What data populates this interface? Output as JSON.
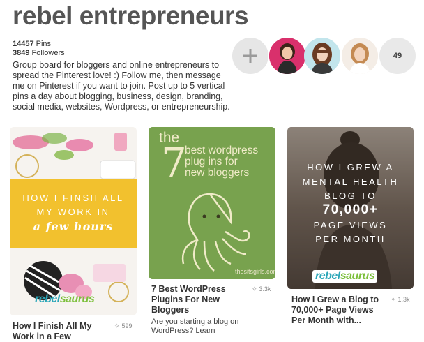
{
  "board": {
    "title": "rebel entrepreneurs",
    "pins_count": "14457",
    "pins_label": "Pins",
    "followers_count": "3849",
    "followers_label": "Followers",
    "description": "Group board for bloggers and online entrepreneurs to spread the Pinterest love! :) Follow me, then message me on Pinterest if you want to join. Post up to 5 vertical pins a day about blogging, business, design, branding, social media, websites, Wordpress, or entrepreneurship."
  },
  "collaborators": {
    "add_icon": "plus-icon",
    "more_count": "49"
  },
  "pins": [
    {
      "title": "How I Finish All My Work in a Few",
      "saves": "599",
      "image_text": [
        "HOW I FINSH ALL",
        "MY WORK IN",
        "a few hours"
      ],
      "logo": [
        "rebel",
        "saurus"
      ]
    },
    {
      "title": "7 Best WordPress Plugins For New Bloggers",
      "description": "Are you starting a blog on WordPress? Learn",
      "saves": "3.3k",
      "image_text": [
        "the",
        "7",
        "best wordpress",
        "plug ins for",
        "new bloggers",
        "thesitsgirls.com"
      ]
    },
    {
      "title": "How I Grew a Blog to 70,000+ Page Views Per Month with...",
      "saves": "1.3k",
      "image_text": [
        "HOW I GREW A",
        "MENTAL HEALTH",
        "BLOG TO",
        "70,000+",
        "PAGE VIEWS",
        "PER MONTH"
      ],
      "logo": [
        "rebel",
        "saurus"
      ]
    }
  ],
  "colors": {
    "accent_yellow": "#f2c12e",
    "pin2_green": "#78a24e",
    "logo_teal": "#2aa6b8",
    "logo_green": "#7bbf3a"
  }
}
